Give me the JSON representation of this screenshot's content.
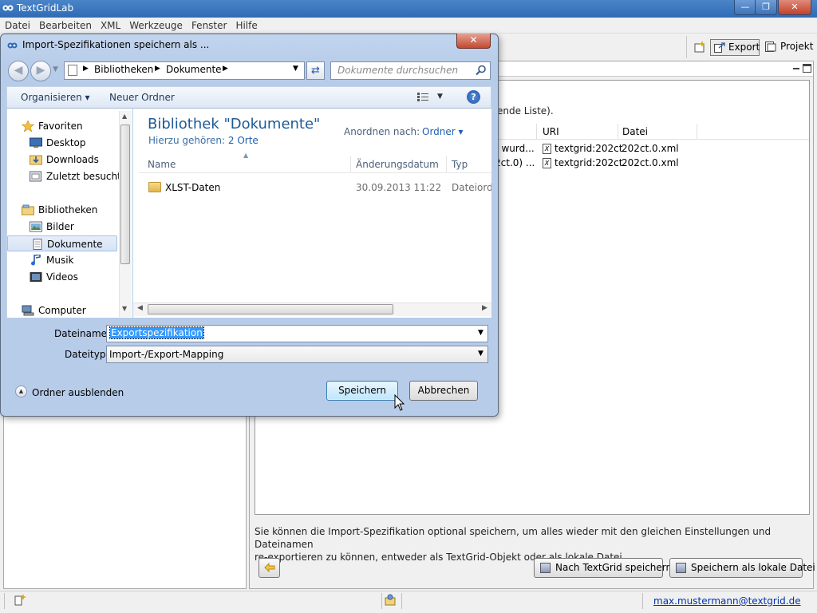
{
  "app": {
    "title": "TextGridLab",
    "menu": [
      "Datei",
      "Bearbeiten",
      "XML",
      "Werkzeuge",
      "Fenster",
      "Hilfe"
    ],
    "window_buttons": {
      "minimize": "—",
      "maximize": "❐",
      "close": "✕"
    }
  },
  "perspectives": {
    "export": "Export",
    "projekt": "Projekt"
  },
  "background": {
    "list_hint": "ende Liste).",
    "table": {
      "headers": [
        "URI",
        "Datei"
      ],
      "rows": [
        {
          "partial": ") wurd...",
          "uri": "textgrid:202ct",
          "datei": "202ct.0.xml"
        },
        {
          "partial": "2ct.0) ...",
          "uri": "textgrid:202ct",
          "datei": "202ct.0.xml"
        }
      ]
    },
    "info_line1": "Sie können die Import-Spezifikation optional speichern, um alles wieder mit den gleichen Einstellungen und Dateinamen",
    "info_line2": "re-exportieren zu können, entweder als TextGrid-Objekt oder als lokale Datei.",
    "btn_save_textgrid": "Nach TextGrid speichern",
    "btn_save_local": "Speichern als lokale Datei",
    "status_user": "max.mustermann@textgrid.de"
  },
  "dialog": {
    "title": "Import-Spezifikationen speichern als ...",
    "breadcrumbs": [
      "Bibliotheken",
      "Dokumente"
    ],
    "search_placeholder": "Dokumente durchsuchen",
    "toolbar": {
      "organize": "Organisieren ▾",
      "new_folder": "Neuer Ordner"
    },
    "nav": [
      {
        "label": "Favoriten",
        "icon": "star-icon"
      },
      {
        "label": "Desktop",
        "icon": "desktop-icon"
      },
      {
        "label": "Downloads",
        "icon": "downloads-icon"
      },
      {
        "label": "Zuletzt besucht",
        "icon": "recent-places-icon"
      },
      {
        "label": "Bibliotheken",
        "icon": "libraries-icon"
      },
      {
        "label": "Bilder",
        "icon": "pictures-icon"
      },
      {
        "label": "Dokumente",
        "icon": "documents-icon"
      },
      {
        "label": "Musik",
        "icon": "music-icon"
      },
      {
        "label": "Videos",
        "icon": "videos-icon"
      },
      {
        "label": "Computer",
        "icon": "computer-icon"
      }
    ],
    "library_title": "Bibliothek \"Dokumente\"",
    "library_sub_prefix": "Hierzu gehören:",
    "library_sub_link": "2 Orte",
    "arrange_label": "Anordnen nach:",
    "arrange_value": "Ordner ▾",
    "columns": [
      "Name",
      "Änderungsdatum",
      "Typ"
    ],
    "folder": {
      "name": "XLST-Daten",
      "date": "30.09.2013 11:22",
      "type": "Dateiordner"
    },
    "filename_label": "Dateiname:",
    "filename_value": "Exportspezifikation",
    "filetype_label": "Dateityp:",
    "filetype_value": "Import-/Export-Mapping",
    "hide_folders": "Ordner ausblenden",
    "save": "Speichern",
    "cancel": "Abbrechen"
  }
}
